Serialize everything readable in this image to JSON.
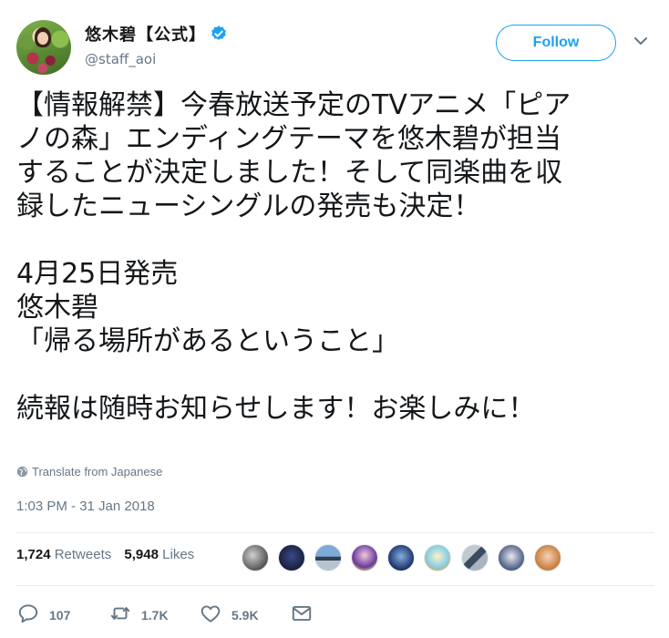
{
  "user": {
    "display_name": "悠木碧【公式】",
    "handle": "@staff_aoi",
    "verified_icon": "verified-badge-icon"
  },
  "follow_label": "Follow",
  "tweet": {
    "lines": [
      "【情報解禁】今春放送予定のTVアニメ「ピア",
      "ノの森」エンディングテーマを悠木碧が担当",
      "することが決定しました！そして同楽曲を収",
      "録したニューシングルの発売も決定！",
      "",
      "4月25日発売",
      "悠木碧",
      "「帰る場所があるということ」",
      "",
      "続報は随時お知らせします！お楽しみに！"
    ]
  },
  "translate_label": "Translate from Japanese",
  "timestamp": "1:03 PM - 31 Jan 2018",
  "stats": {
    "retweets_count": "1,724",
    "retweets_label": "Retweets",
    "likes_count": "5,948",
    "likes_label": "Likes"
  },
  "actions": {
    "reply_count": "107",
    "retweet_count": "1.7K",
    "like_count": "5.9K"
  },
  "colors": {
    "accent": "#1da1f2",
    "secondary_text": "#657786",
    "border": "#e6ecf0"
  }
}
